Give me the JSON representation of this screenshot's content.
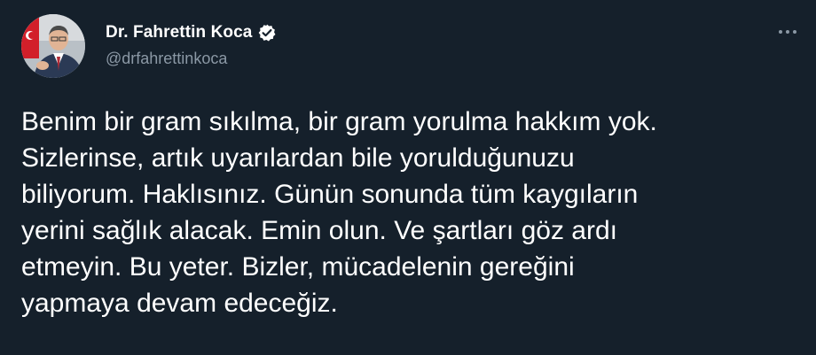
{
  "author": {
    "display_name": "Dr. Fahrettin Koca",
    "handle": "@drfahrettinkoca",
    "verified_icon": "verified-badge-icon",
    "avatar_icon": "avatar-photo"
  },
  "menu": {
    "icon": "more-options-icon"
  },
  "tweet": {
    "lines": [
      "Benim bir gram sıkılma, bir gram yorulma hakkım yok.",
      "Sizlerinse, artık uyarılardan bile yorulduğunuzu",
      "biliyorum. Haklısınız. Günün sonunda tüm kaygıların",
      "yerini sağlık alacak. Emin olun. Ve şartları göz ardı",
      "etmeyin. Bu yeter. Bizler, mücadelenin gereğini",
      "yapmaya devam edeceğiz."
    ]
  },
  "colors": {
    "background": "#15202b",
    "text_primary": "#ffffff",
    "text_secondary": "#8b98a5",
    "verified_badge": "#ffffff"
  }
}
